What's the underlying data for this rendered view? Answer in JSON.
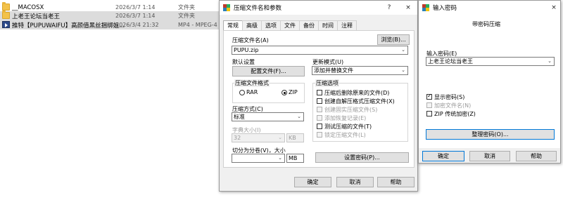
{
  "explorer": {
    "files": [
      {
        "name": "__MACOSX",
        "date": "2026/3/7 1:14",
        "type": "文件夹",
        "icon": "folder-icon"
      },
      {
        "name": "上老王论坛当老王",
        "date": "2026/3/7 1:14",
        "type": "文件夹",
        "icon": "folder-icon"
      },
      {
        "name": "推特【PUPUWAIFU】高颜值黑丝捆绑姐...",
        "date": "2026/3/4 21:32",
        "type": "MP4 - MPEG-4 ...",
        "icon": "video-file-icon"
      }
    ]
  },
  "compress_dialog": {
    "title": "压缩文件名和参数",
    "help": "?",
    "close": "×",
    "tabs": [
      "常规",
      "高级",
      "选项",
      "文件",
      "备份",
      "时间",
      "注释"
    ],
    "archive_name_label": "压缩文件名(A)",
    "archive_name_value": "PUPU.zip",
    "browse_button": "浏览(B)...",
    "default_settings_label": "默认设置",
    "profiles_button": "配置文件(F)...",
    "update_mode_label": "更新模式(U)",
    "update_mode_value": "添加并替换文件",
    "format_group_title": "压缩文件格式",
    "format_rar": "RAR",
    "format_zip": "ZIP",
    "format_selected": "ZIP",
    "method_label": "压缩方式(C)",
    "method_value": "标准",
    "dict_size_label": "字典大小(I)",
    "dict_size_value": "32",
    "dict_size_unit": "KB",
    "split_label": "切分为分卷(V)，大小",
    "split_value": "",
    "split_unit": "MB",
    "options_group_title": "压缩选项",
    "options": [
      {
        "label": "压缩后删除原来的文件(D)",
        "checked": false,
        "disabled": false
      },
      {
        "label": "创建自解压格式压缩文件(X)",
        "checked": false,
        "disabled": false
      },
      {
        "label": "创建固实压缩文件(S)",
        "checked": false,
        "disabled": true
      },
      {
        "label": "添加恢复记录(E)",
        "checked": false,
        "disabled": true
      },
      {
        "label": "测试压缩的文件(T)",
        "checked": false,
        "disabled": false
      },
      {
        "label": "锁定压缩文件(L)",
        "checked": false,
        "disabled": true
      }
    ],
    "set_password_button": "设置密码(P)...",
    "ok_button": "确定",
    "cancel_button": "取消",
    "help_button": "帮助"
  },
  "password_dialog": {
    "title": "输入密码",
    "close": "×",
    "subtitle": "带密码压缩",
    "password_label": "输入密码(E)",
    "password_value": "上老王论坛当老王",
    "options": [
      {
        "label": "显示密码(S)",
        "checked": true,
        "disabled": false
      },
      {
        "label": "加密文件名(N)",
        "checked": false,
        "disabled": true
      },
      {
        "label": "ZIP 传统加密(Z)",
        "checked": false,
        "disabled": false
      }
    ],
    "organize_button": "整理密码(O)...",
    "ok_button": "确定",
    "cancel_button": "取消",
    "help_button": "帮助"
  }
}
